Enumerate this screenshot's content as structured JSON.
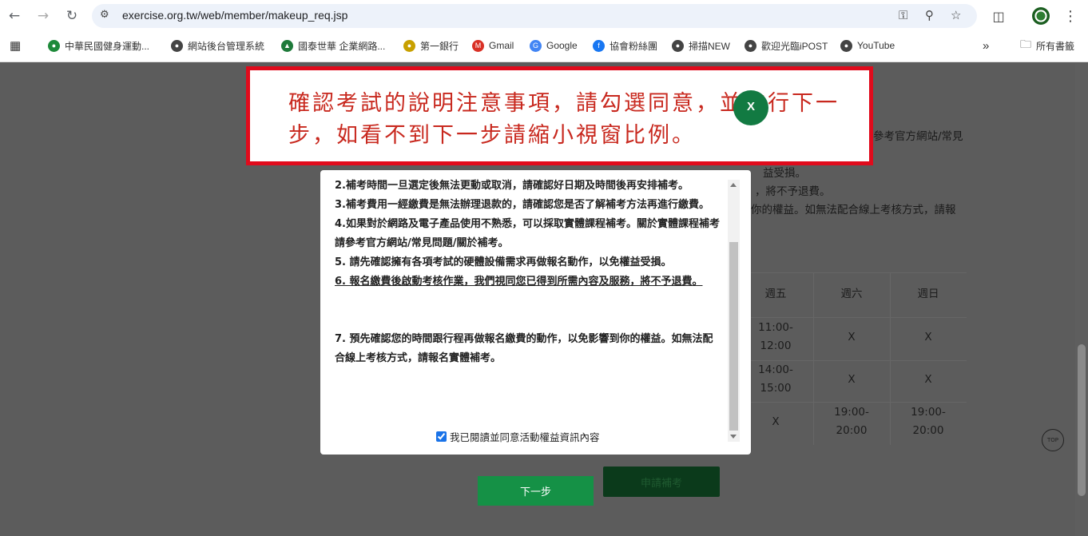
{
  "browser": {
    "url": "exercise.org.tw/web/member/makeup_req.jsp",
    "bookmarks": [
      {
        "label": "中華民國健身運動...",
        "color": "#1e8a3a"
      },
      {
        "label": "網站後台管理系統",
        "color": "#444444"
      },
      {
        "label": "國泰世華 企業網路...",
        "color": "#1e7a3a"
      },
      {
        "label": "第一銀行",
        "color": "#c8a000"
      },
      {
        "label": "Gmail",
        "color": "#d93025"
      },
      {
        "label": "Google",
        "color": "#4285f4"
      },
      {
        "label": "協會粉絲團",
        "color": "#1877f2"
      },
      {
        "label": "掃描NEW",
        "color": "#444444"
      },
      {
        "label": "歡迎光臨iPOST",
        "color": "#444444"
      },
      {
        "label": "YouTube",
        "color": "#444444"
      }
    ],
    "all_bookmarks": "所有書籤"
  },
  "banner": {
    "text": "確認考試的說明注意事項，請勾選同意，並進行下一步，如看不到下一步請縮小視窗比例。"
  },
  "modal": {
    "paragraphs": [
      "2.補考時間一旦選定後無法更動或取消，請確認好日期及時間後再安排補考。",
      "3.補考費用一經繳費是無法辦理退款的，請確認您是否了解補考方法再進行繳費。",
      "4.如果對於網路及電子產品使用不熟悉，可以採取實體課程補考。關於實體課程補考請參考官方網站/常見問題/關於補考。",
      "5. 請先確認擁有各項考試的硬體設備需求再做報名動作，以免權益受損。",
      "6. 報名繳費後啟動考核作業，我們視同您已得到所需內容及服務，將不予退費。",
      "7. 預先確認您的時間跟行程再做報名繳費的動作，以免影響到你的權益。如無法配合線上考核方式，請報名實體補考。"
    ],
    "agree_label": "我已閱讀並同意活動權益資訊內容",
    "agree_checked": true,
    "close_label": "X"
  },
  "background": {
    "lines": [
      "參考官方網站/常見",
      "益受損。",
      "，將不予退費。",
      "你的權益。如無法配合線上考核方式，請報"
    ],
    "table": {
      "headers": [
        "週五",
        "週六",
        "週日"
      ],
      "rows": [
        [
          "11:00-12:00",
          "X",
          "X"
        ],
        [
          "14:00-15:00",
          "X",
          "X"
        ],
        [
          "X",
          "19:00-20:00",
          "19:00-20:00"
        ]
      ]
    },
    "top_label": "TOP"
  },
  "buttons": {
    "next": "下一步",
    "apply": "申請補考"
  }
}
